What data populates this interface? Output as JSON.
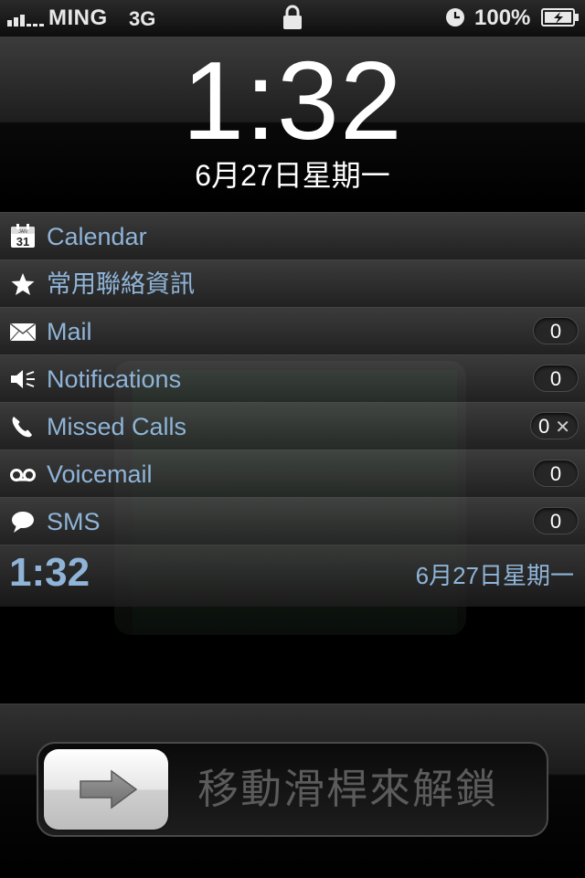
{
  "status_bar": {
    "carrier": "MING",
    "network": "3G",
    "battery_percent": "100%",
    "icons": [
      "signal-icon",
      "lock-icon",
      "alarm-clock-icon",
      "battery-charging-icon"
    ]
  },
  "lock_clock": {
    "time": "1:32",
    "date": "6月27日星期一"
  },
  "notifications": {
    "rows": [
      {
        "icon": "calendar-icon",
        "label": "Calendar",
        "count": null
      },
      {
        "icon": "star-icon",
        "label": "常用聯絡資訊",
        "count": null
      },
      {
        "icon": "mail-icon",
        "label": "Mail",
        "count": "0"
      },
      {
        "icon": "speaker-icon",
        "label": "Notifications",
        "count": "0"
      },
      {
        "icon": "phone-icon",
        "label": "Missed Calls",
        "count": "0",
        "dismiss": "✕"
      },
      {
        "icon": "voicemail-icon",
        "label": "Voicemail",
        "count": "0"
      },
      {
        "icon": "speech-bubble-icon",
        "label": "SMS",
        "count": "0"
      }
    ],
    "calendar_icon_day": "31",
    "calendar_icon_month": "JAN"
  },
  "footer": {
    "time": "1:32",
    "date": "6月27日星期一"
  },
  "unlock": {
    "label": "移動滑桿來解鎖",
    "knob_icon": "right-arrow-icon"
  },
  "colors": {
    "accent_text": "#8fb4d8",
    "slider_text": "#5b5b5b"
  }
}
